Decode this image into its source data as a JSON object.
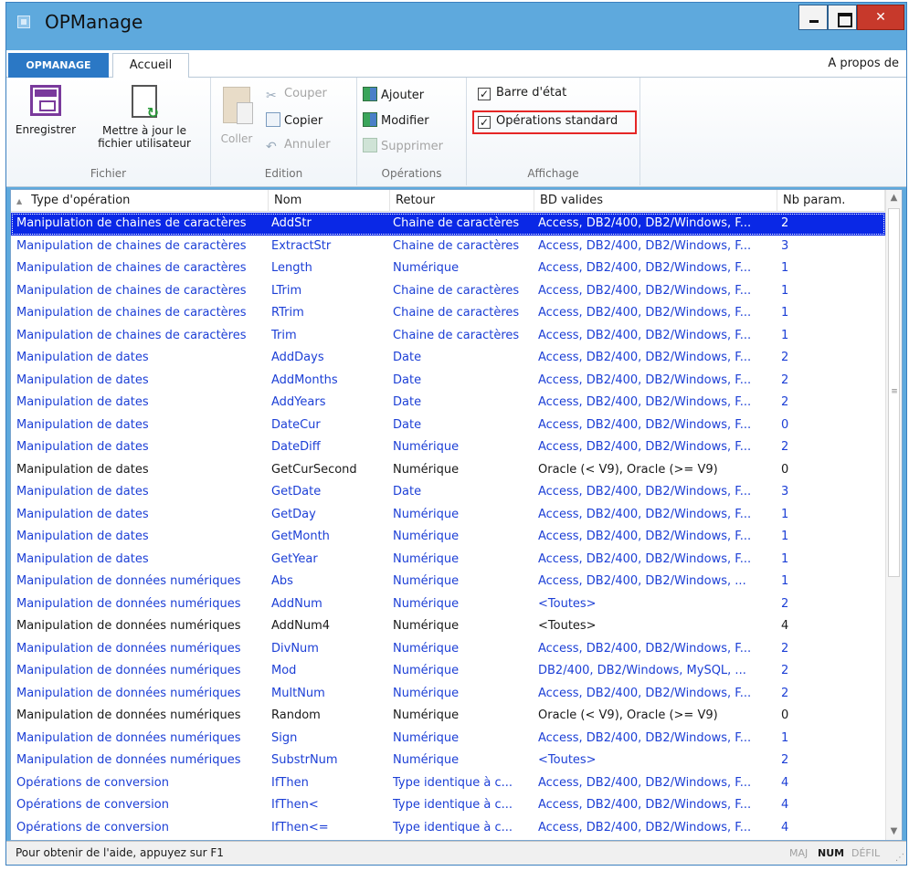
{
  "window": {
    "title": "OPManage"
  },
  "ribbon": {
    "tab_file": "OPMANAGE",
    "tab_home": "Accueil",
    "about": "A propos de",
    "groups": {
      "fichier": {
        "label": "Fichier",
        "save": "Enregistrer",
        "update_line1": "Mettre à jour le",
        "update_line2": "fichier utilisateur"
      },
      "edition": {
        "label": "Edition",
        "paste": "Coller",
        "cut": "Couper",
        "copy": "Copier",
        "undo": "Annuler"
      },
      "operations": {
        "label": "Opérations",
        "add": "Ajouter",
        "modify": "Modifier",
        "delete": "Supprimer"
      },
      "affichage": {
        "label": "Affichage",
        "status_bar": "Barre d'état",
        "standard_ops": "Opérations standard",
        "status_bar_checked": true,
        "standard_ops_checked": true
      }
    }
  },
  "table": {
    "columns": [
      "Type d'opération",
      "Nom",
      "Retour",
      "BD valides",
      "Nb param."
    ],
    "rows": [
      {
        "type": "Manipulation de chaines de caractères",
        "nom": "AddStr",
        "retour": "Chaine de caractères",
        "bd": "Access, DB2/400, DB2/Windows, F...",
        "nb": "2",
        "style": "selected"
      },
      {
        "type": "Manipulation de chaines de caractères",
        "nom": "ExtractStr",
        "retour": "Chaine de caractères",
        "bd": "Access, DB2/400, DB2/Windows, F...",
        "nb": "3",
        "style": "link"
      },
      {
        "type": "Manipulation de chaines de caractères",
        "nom": "Length",
        "retour": "Numérique",
        "bd": "Access, DB2/400, DB2/Windows, F...",
        "nb": "1",
        "style": "link"
      },
      {
        "type": "Manipulation de chaines de caractères",
        "nom": "LTrim",
        "retour": "Chaine de caractères",
        "bd": "Access, DB2/400, DB2/Windows, F...",
        "nb": "1",
        "style": "link"
      },
      {
        "type": "Manipulation de chaines de caractères",
        "nom": "RTrim",
        "retour": "Chaine de caractères",
        "bd": "Access, DB2/400, DB2/Windows, F...",
        "nb": "1",
        "style": "link"
      },
      {
        "type": "Manipulation de chaines de caractères",
        "nom": "Trim",
        "retour": "Chaine de caractères",
        "bd": "Access, DB2/400, DB2/Windows, F...",
        "nb": "1",
        "style": "link"
      },
      {
        "type": "Manipulation de dates",
        "nom": "AddDays",
        "retour": "Date",
        "bd": "Access, DB2/400, DB2/Windows, F...",
        "nb": "2",
        "style": "link"
      },
      {
        "type": "Manipulation de dates",
        "nom": "AddMonths",
        "retour": "Date",
        "bd": "Access, DB2/400, DB2/Windows, F...",
        "nb": "2",
        "style": "link"
      },
      {
        "type": "Manipulation de dates",
        "nom": "AddYears",
        "retour": "Date",
        "bd": "Access, DB2/400, DB2/Windows, F...",
        "nb": "2",
        "style": "link"
      },
      {
        "type": "Manipulation de dates",
        "nom": "DateCur",
        "retour": "Date",
        "bd": "Access, DB2/400, DB2/Windows, F...",
        "nb": "0",
        "style": "link"
      },
      {
        "type": "Manipulation de dates",
        "nom": "DateDiff",
        "retour": "Numérique",
        "bd": "Access, DB2/400, DB2/Windows, F...",
        "nb": "2",
        "style": "link"
      },
      {
        "type": "Manipulation de dates",
        "nom": "GetCurSecond",
        "retour": "Numérique",
        "bd": "Oracle (< V9), Oracle (>= V9)",
        "nb": "0",
        "style": "normal"
      },
      {
        "type": "Manipulation de dates",
        "nom": "GetDate",
        "retour": "Date",
        "bd": "Access, DB2/400, DB2/Windows, F...",
        "nb": "3",
        "style": "link"
      },
      {
        "type": "Manipulation de dates",
        "nom": "GetDay",
        "retour": "Numérique",
        "bd": "Access, DB2/400, DB2/Windows, F...",
        "nb": "1",
        "style": "link"
      },
      {
        "type": "Manipulation de dates",
        "nom": "GetMonth",
        "retour": "Numérique",
        "bd": "Access, DB2/400, DB2/Windows, F...",
        "nb": "1",
        "style": "link"
      },
      {
        "type": "Manipulation de dates",
        "nom": "GetYear",
        "retour": "Numérique",
        "bd": "Access, DB2/400, DB2/Windows, F...",
        "nb": "1",
        "style": "link"
      },
      {
        "type": "Manipulation de données numériques",
        "nom": "Abs",
        "retour": "Numérique",
        "bd": "Access, DB2/400, DB2/Windows, ...",
        "nb": "1",
        "style": "link"
      },
      {
        "type": "Manipulation de données numériques",
        "nom": "AddNum",
        "retour": "Numérique",
        "bd": "<Toutes>",
        "nb": "2",
        "style": "link"
      },
      {
        "type": "Manipulation de données numériques",
        "nom": "AddNum4",
        "retour": "Numérique",
        "bd": "<Toutes>",
        "nb": "4",
        "style": "normal"
      },
      {
        "type": "Manipulation de données numériques",
        "nom": "DivNum",
        "retour": "Numérique",
        "bd": "Access, DB2/400, DB2/Windows, F...",
        "nb": "2",
        "style": "link"
      },
      {
        "type": "Manipulation de données numériques",
        "nom": "Mod",
        "retour": "Numérique",
        "bd": "DB2/400, DB2/Windows, MySQL, ...",
        "nb": "2",
        "style": "link"
      },
      {
        "type": "Manipulation de données numériques",
        "nom": "MultNum",
        "retour": "Numérique",
        "bd": "Access, DB2/400, DB2/Windows, F...",
        "nb": "2",
        "style": "link"
      },
      {
        "type": "Manipulation de données numériques",
        "nom": "Random",
        "retour": "Numérique",
        "bd": "Oracle (< V9), Oracle (>= V9)",
        "nb": "0",
        "style": "normal"
      },
      {
        "type": "Manipulation de données numériques",
        "nom": "Sign",
        "retour": "Numérique",
        "bd": "Access, DB2/400, DB2/Windows, F...",
        "nb": "1",
        "style": "link"
      },
      {
        "type": "Manipulation de données numériques",
        "nom": "SubstrNum",
        "retour": "Numérique",
        "bd": "<Toutes>",
        "nb": "2",
        "style": "link"
      },
      {
        "type": "Opérations de conversion",
        "nom": "IfThen",
        "retour": "Type identique à c...",
        "bd": "Access, DB2/400, DB2/Windows, F...",
        "nb": "4",
        "style": "link"
      },
      {
        "type": "Opérations de conversion",
        "nom": "IfThen<",
        "retour": "Type identique à c...",
        "bd": "Access, DB2/400, DB2/Windows, F...",
        "nb": "4",
        "style": "link"
      },
      {
        "type": "Opérations de conversion",
        "nom": "IfThen<=",
        "retour": "Type identique à c...",
        "bd": "Access, DB2/400, DB2/Windows, F...",
        "nb": "4",
        "style": "link"
      }
    ]
  },
  "statusbar": {
    "text": "Pour obtenir de l'aide, appuyez sur F1",
    "maj": "MAJ",
    "num": "NUM",
    "defil": "DÉFIL"
  },
  "colors": {
    "title_bar": "#5ea9dd",
    "selected_row": "#0a28e6",
    "link_text": "#1c3fd6",
    "highlight_box": "#e52626"
  }
}
